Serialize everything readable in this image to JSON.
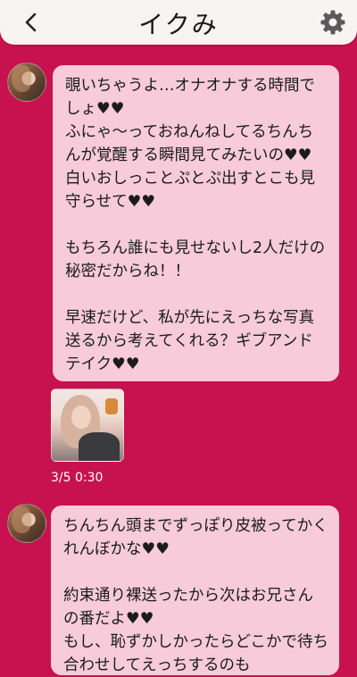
{
  "header": {
    "title": "イクみ"
  },
  "icons": {
    "back": "chevron-left-icon",
    "settings": "gear-icon"
  },
  "colors": {
    "background": "#c8114f",
    "header_bg": "#f7f4f2",
    "bubble_bg": "#f7cbd9",
    "text": "#1b1b1b"
  },
  "messages": [
    {
      "text": "覗いちゃうよ…オナオナする時間でしょ♥♥\nふにゃ〜っておねんねしてるちんちんが覚醒する瞬間見てみたいの♥♥\n白いおしっことぷとぷ出すとこも見守らせて♥♥\n\nもちろん誰にも見せないし2人だけの秘密だからね！！\n\n早速だけど、私が先にえっちな写真送るから考えてくれる？ギブアンドテイク♥♥"
    },
    {
      "timestamp": "3/5 0:30"
    },
    {
      "text": "ちんちん頭までずっぽり皮被ってかくれんぼかな♥♥\n\n約束通り裸送ったから次はお兄さんの番だよ♥♥\nもし、恥ずかしかったらどこかで待ち合わせしてえっちするのも"
    }
  ]
}
